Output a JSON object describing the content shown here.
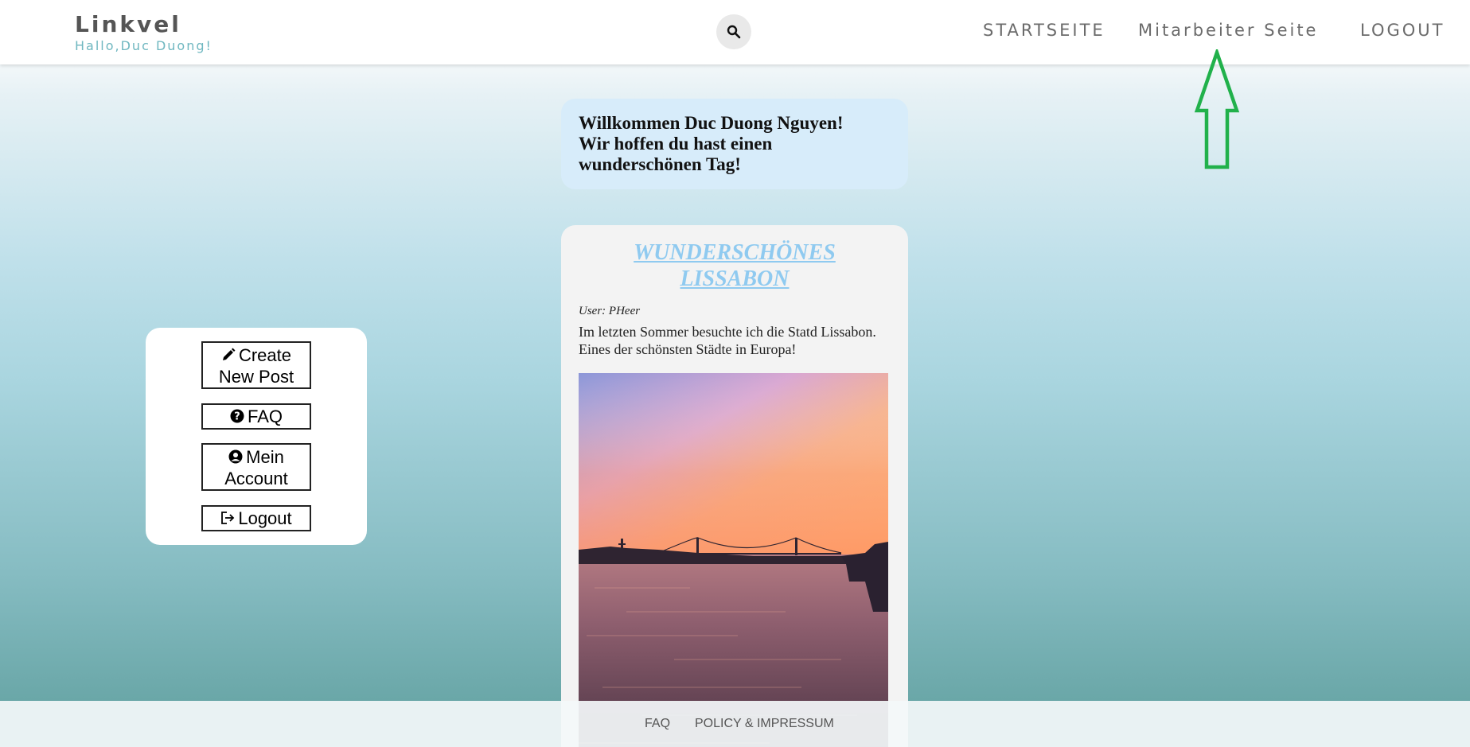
{
  "header": {
    "brand": "Linkvel",
    "greeting": "Hallo,Duc Duong!",
    "nav": {
      "start": "STARTSEITE",
      "mitarbeiter": "Mitarbeiter Seite",
      "logout": "LOGOUT"
    }
  },
  "welcome": {
    "line1": "Willkommen Duc Duong Nguyen!",
    "line2": "Wir hoffen du hast einen",
    "line3": "wunderschönen Tag!"
  },
  "post": {
    "title_line1": "WUNDERSCHÖNES",
    "title_line2": "LISSABON",
    "user": "User: PHeer",
    "body": "Im letzten Sommer besuchte ich die Statd Lissabon. Eines der schönsten Städte in Europa!"
  },
  "sidebar": {
    "create_line1": "Create",
    "create_line2": "New Post",
    "faq": "FAQ",
    "account_line1": "Mein",
    "account_line2": "Account",
    "logout": "Logout"
  },
  "footer": {
    "faq": "FAQ",
    "policy": "POLICY & IMPRESSUM"
  },
  "colors": {
    "brand_sub": "#6fb7c0",
    "post_title": "#8fcaf0",
    "welcome_bg": "#d7ecfa",
    "annotation_arrow": "#21b14b"
  }
}
